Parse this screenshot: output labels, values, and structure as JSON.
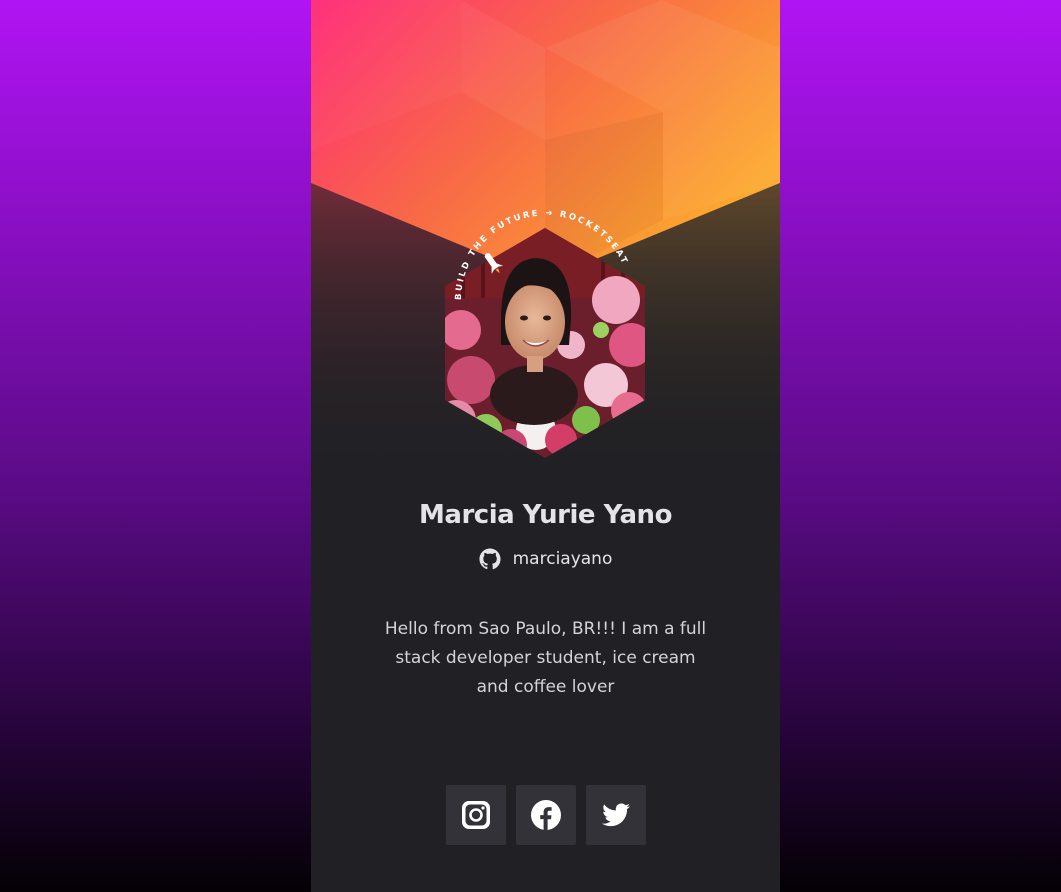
{
  "profile": {
    "name": "Marcia Yurie Yano",
    "github_username": "marciayano",
    "bio": "Hello from Sao Paulo, BR!!! I am a full stack developer student, ice cream and coffee lover"
  },
  "badge": {
    "ring_text": "BUILD THE FUTURE ➔ ROCKETSEAT"
  },
  "socials": [
    {
      "name": "instagram",
      "icon": "instagram-icon"
    },
    {
      "name": "facebook",
      "icon": "facebook-icon"
    },
    {
      "name": "twitter",
      "icon": "twitter-icon"
    }
  ],
  "colors": {
    "page_top": "#b014f3",
    "page_bottom": "#030104",
    "card_bg": "#212125",
    "banner_left": "#ff2d75",
    "banner_right": "#fca832",
    "social_bg": "#323238",
    "text": "#e4e4e7"
  }
}
